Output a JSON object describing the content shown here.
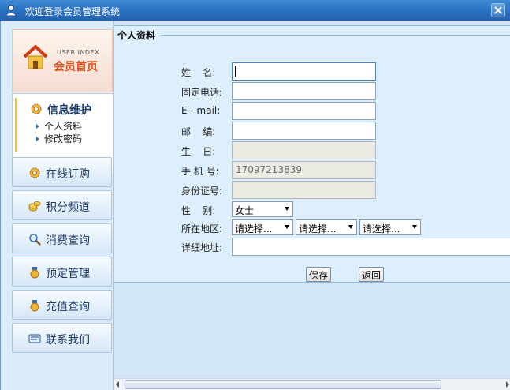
{
  "window": {
    "title": "欢迎登录会员管理系统",
    "app_icon": "user-icon",
    "close_icon": "close-icon"
  },
  "sidebar": {
    "home": {
      "small_label": "USER INDEX",
      "label": "会员首页",
      "icon": "house-icon"
    },
    "active_section": {
      "label": "信息维护",
      "icon": "gear-icon",
      "items": [
        {
          "label": "个人资料"
        },
        {
          "label": "修改密码"
        }
      ]
    },
    "items": [
      {
        "label": "在线订购",
        "icon": "gear-icon"
      },
      {
        "label": "积分频道",
        "icon": "coins-icon"
      },
      {
        "label": "消费查询",
        "icon": "search-icon"
      },
      {
        "label": "预定管理",
        "icon": "medal-icon"
      },
      {
        "label": "充值查询",
        "icon": "medal-icon"
      },
      {
        "label": "联系我们",
        "icon": "contact-card-icon"
      }
    ]
  },
  "main": {
    "section_title": "个人资料",
    "form": {
      "name": {
        "label": "姓    名:",
        "value": ""
      },
      "phone": {
        "label": "固定电话:",
        "value": ""
      },
      "email": {
        "label": "E - mail:",
        "value": ""
      },
      "postcode": {
        "label": "邮    编:",
        "value": ""
      },
      "birthday": {
        "label": "生    日:",
        "value": ""
      },
      "mobile": {
        "label": "手 机 号:",
        "value": "17097213839"
      },
      "id_number": {
        "label": "身份证号:",
        "value": ""
      },
      "gender": {
        "label": "性    别:",
        "value": "女士"
      },
      "region": {
        "label": "所在地区:",
        "province": "请选择...",
        "city": "请选择...",
        "district": "请选择..."
      },
      "address": {
        "label": "详细地址:",
        "value": ""
      }
    },
    "buttons": {
      "save": "保存",
      "back": "返回"
    }
  },
  "colors": {
    "titlebar": "#2a6fc0",
    "background": "#d3e6f8",
    "panel": "#ddeefc",
    "home_accent": "#d9531c"
  }
}
